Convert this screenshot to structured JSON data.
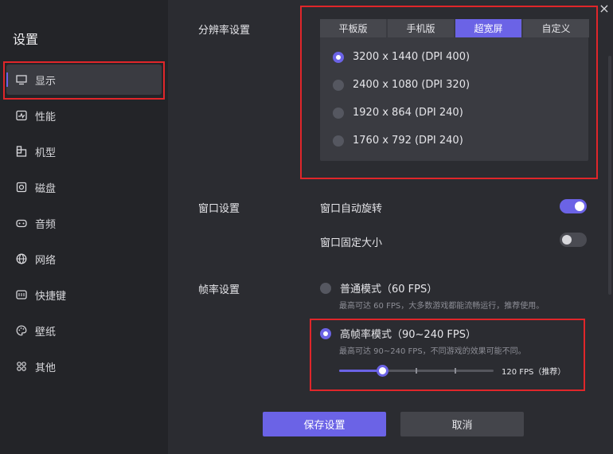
{
  "sidebar": {
    "title": "设置",
    "items": [
      {
        "label": "显示",
        "icon": "monitor-icon",
        "active": true
      },
      {
        "label": "性能",
        "icon": "performance-icon"
      },
      {
        "label": "机型",
        "icon": "device-icon"
      },
      {
        "label": "磁盘",
        "icon": "disk-icon"
      },
      {
        "label": "音频",
        "icon": "audio-icon"
      },
      {
        "label": "网络",
        "icon": "globe-icon"
      },
      {
        "label": "快捷键",
        "icon": "keyboard-icon"
      },
      {
        "label": "壁纸",
        "icon": "palette-icon"
      },
      {
        "label": "其他",
        "icon": "grid-icon"
      }
    ]
  },
  "resolution": {
    "section_label": "分辨率设置",
    "tabs": [
      "平板版",
      "手机版",
      "超宽屏",
      "自定义"
    ],
    "active_tab": "超宽屏",
    "options": [
      {
        "label": "3200 x 1440  (DPI 400)",
        "selected": true
      },
      {
        "label": "2400 x 1080  (DPI 320)",
        "selected": false
      },
      {
        "label": "1920 x 864  (DPI 240)",
        "selected": false
      },
      {
        "label": "1760 x 792  (DPI 240)",
        "selected": false
      }
    ]
  },
  "window": {
    "section_label": "窗口设置",
    "auto_rotate_label": "窗口自动旋转",
    "auto_rotate_on": true,
    "fixed_size_label": "窗口固定大小",
    "fixed_size_on": false
  },
  "framerate": {
    "section_label": "帧率设置",
    "normal_title": "普通模式（60 FPS）",
    "normal_desc": "最高可达 60 FPS，大多数游戏都能流畅运行，推荐使用。",
    "normal_selected": false,
    "high_title": "高帧率模式（90~240 FPS）",
    "high_desc": "最高可达 90~240 FPS，不同游戏的效果可能不同。",
    "high_selected": true,
    "slider_value_label": "120 FPS（推荐）",
    "slider_fraction": 0.28
  },
  "actions": {
    "save_label": "保存设置",
    "cancel_label": "取消"
  },
  "window_controls": {
    "close_glyph": "×"
  },
  "colors": {
    "accent": "#6b63e6",
    "highlight": "#e0262a",
    "sidebar_bg": "#232428",
    "main_bg": "#2b2c31"
  }
}
